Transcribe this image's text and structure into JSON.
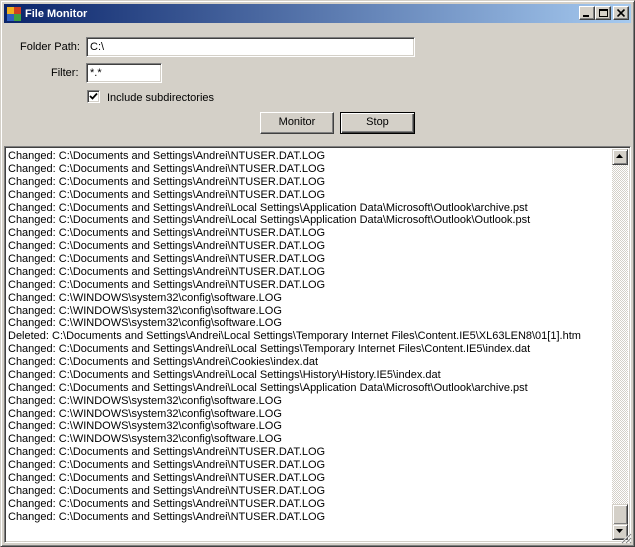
{
  "window": {
    "title": "File Monitor"
  },
  "form": {
    "folder_path_label": "Folder Path:",
    "folder_path_value": "C:\\",
    "filter_label": "Filter:",
    "filter_value": "*.*",
    "include_subdirs_label": "Include subdirectories",
    "include_subdirs_checked": true,
    "monitor_button": "Monitor",
    "stop_button": "Stop"
  },
  "log": {
    "lines": [
      "Changed: C:\\Documents and Settings\\Andrei\\NTUSER.DAT.LOG",
      "Changed: C:\\Documents and Settings\\Andrei\\NTUSER.DAT.LOG",
      "Changed: C:\\Documents and Settings\\Andrei\\NTUSER.DAT.LOG",
      "Changed: C:\\Documents and Settings\\Andrei\\NTUSER.DAT.LOG",
      "Changed: C:\\Documents and Settings\\Andrei\\Local Settings\\Application Data\\Microsoft\\Outlook\\archive.pst",
      "Changed: C:\\Documents and Settings\\Andrei\\Local Settings\\Application Data\\Microsoft\\Outlook\\Outlook.pst",
      "Changed: C:\\Documents and Settings\\Andrei\\NTUSER.DAT.LOG",
      "Changed: C:\\Documents and Settings\\Andrei\\NTUSER.DAT.LOG",
      "Changed: C:\\Documents and Settings\\Andrei\\NTUSER.DAT.LOG",
      "Changed: C:\\Documents and Settings\\Andrei\\NTUSER.DAT.LOG",
      "Changed: C:\\Documents and Settings\\Andrei\\NTUSER.DAT.LOG",
      "Changed: C:\\WINDOWS\\system32\\config\\software.LOG",
      "Changed: C:\\WINDOWS\\system32\\config\\software.LOG",
      "Changed: C:\\WINDOWS\\system32\\config\\software.LOG",
      "Deleted: C:\\Documents and Settings\\Andrei\\Local Settings\\Temporary Internet Files\\Content.IE5\\XL63LEN8\\01[1].htm",
      "Changed: C:\\Documents and Settings\\Andrei\\Local Settings\\Temporary Internet Files\\Content.IE5\\index.dat",
      "Changed: C:\\Documents and Settings\\Andrei\\Cookies\\index.dat",
      "Changed: C:\\Documents and Settings\\Andrei\\Local Settings\\History\\History.IE5\\index.dat",
      "Changed: C:\\Documents and Settings\\Andrei\\Local Settings\\Application Data\\Microsoft\\Outlook\\archive.pst",
      "Changed: C:\\WINDOWS\\system32\\config\\software.LOG",
      "Changed: C:\\WINDOWS\\system32\\config\\software.LOG",
      "Changed: C:\\WINDOWS\\system32\\config\\software.LOG",
      "Changed: C:\\WINDOWS\\system32\\config\\software.LOG",
      "Changed: C:\\Documents and Settings\\Andrei\\NTUSER.DAT.LOG",
      "Changed: C:\\Documents and Settings\\Andrei\\NTUSER.DAT.LOG",
      "Changed: C:\\Documents and Settings\\Andrei\\NTUSER.DAT.LOG",
      "Changed: C:\\Documents and Settings\\Andrei\\NTUSER.DAT.LOG",
      "Changed: C:\\Documents and Settings\\Andrei\\NTUSER.DAT.LOG",
      "Changed: C:\\Documents and Settings\\Andrei\\NTUSER.DAT.LOG"
    ]
  },
  "icons": {
    "app": "app-grid-icon",
    "minimize": "minimize-icon",
    "maximize": "maximize-icon",
    "close": "close-icon",
    "scroll_up": "scroll-up-arrow-icon",
    "scroll_down": "scroll-down-arrow-icon",
    "checkmark": "checkmark-icon",
    "size_grip": "size-grip-icon"
  },
  "colors": {
    "titlebar_start": "#0a246a",
    "titlebar_end": "#a6caf0",
    "face": "#d4d0c8"
  }
}
